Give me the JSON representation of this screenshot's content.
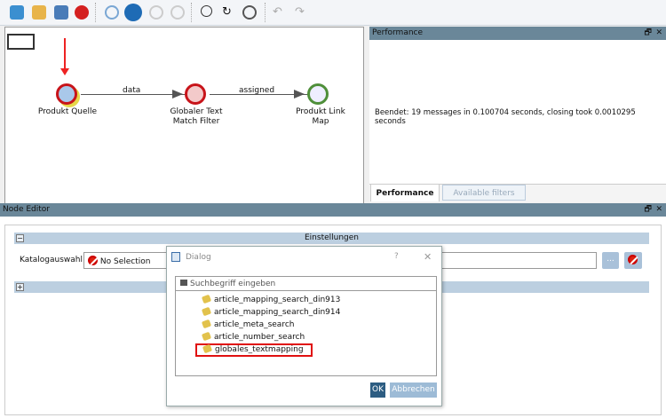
{
  "toolbar": {
    "icons": [
      "open-folder-icon",
      "open-file-icon",
      "save-icon",
      "stop-icon",
      "play-icon",
      "cloud-icon",
      "pause-icon",
      "stop-run-icon",
      "layout-icon",
      "refresh-icon",
      "zoom-region-icon",
      "undo-icon",
      "redo-icon"
    ]
  },
  "canvas": {
    "nodes": [
      {
        "label1": "Produkt Quelle",
        "label2": ""
      },
      {
        "label1": "Globaler Text",
        "label2": "Match Filter"
      },
      {
        "label1": "Produkt Link",
        "label2": "Map"
      }
    ],
    "edges": [
      "data",
      "assigned"
    ]
  },
  "performance": {
    "title": "Performance",
    "message": "Beendet: 19 messages in 0.100704 seconds, closing took 0.0010295 seconds",
    "tabs": [
      "Performance",
      "Available filters"
    ]
  },
  "node_editor": {
    "title": "Node Editor",
    "section": "Einstellungen",
    "catalog_label": "Katalogauswahl:",
    "catalog_value": "No Selection",
    "browse": "..."
  },
  "dialog": {
    "title": "Dialog",
    "help": "?",
    "close": "✕",
    "search_placeholder": "Suchbegriff eingeben",
    "items": [
      "article_mapping_search_din913",
      "article_mapping_search_din914",
      "article_meta_search",
      "article_number_search",
      "globales_textmapping"
    ],
    "ok": "OK",
    "cancel": "Abbrechen"
  },
  "panel_controls": {
    "restore": "🗗",
    "close": "✕"
  }
}
